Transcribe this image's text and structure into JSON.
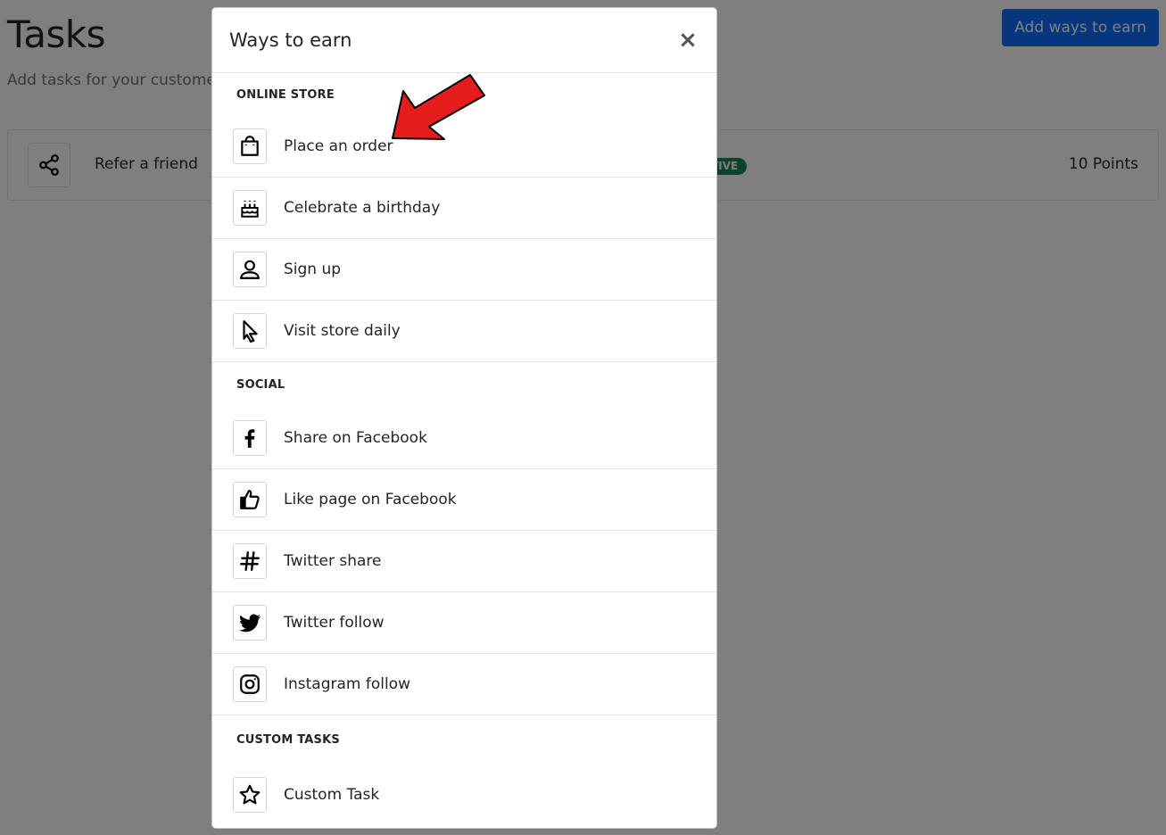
{
  "page": {
    "title": "Tasks",
    "description": "Add tasks for your customers your page on facebook etc.",
    "add_button": "Add ways to earn"
  },
  "task": {
    "icon": "share-icon",
    "name": "Refer a friend",
    "status": "ACTIVE",
    "points": "10 Points"
  },
  "modal": {
    "title": "Ways to earn",
    "close": "×",
    "sections": [
      {
        "heading": "ONLINE STORE",
        "items": [
          {
            "label": "Place an order",
            "icon": "shopping-bag-icon"
          },
          {
            "label": "Celebrate a birthday",
            "icon": "birthday-cake-icon"
          },
          {
            "label": "Sign up",
            "icon": "user-icon"
          },
          {
            "label": "Visit store daily",
            "icon": "pointer-icon"
          }
        ]
      },
      {
        "heading": "SOCIAL",
        "items": [
          {
            "label": "Share on Facebook",
            "icon": "facebook-icon"
          },
          {
            "label": "Like page on Facebook",
            "icon": "thumbs-up-icon"
          },
          {
            "label": "Twitter share",
            "icon": "hashtag-icon"
          },
          {
            "label": "Twitter follow",
            "icon": "twitter-icon"
          },
          {
            "label": "Instagram follow",
            "icon": "instagram-icon"
          }
        ]
      },
      {
        "heading": "CUSTOM TASKS",
        "items": [
          {
            "label": "Custom Task",
            "icon": "star-icon"
          }
        ]
      }
    ]
  },
  "colors": {
    "primary": "#0d6efd",
    "badge": "#198754",
    "arrow": "#e41c1c"
  }
}
